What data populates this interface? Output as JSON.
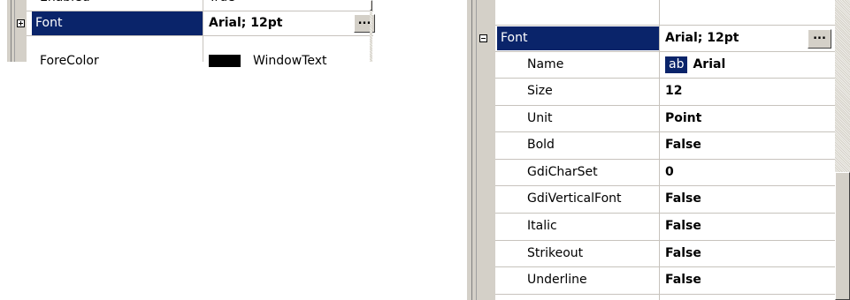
{
  "left_grid": {
    "prev_row": {
      "name": "Enabled",
      "value": "True"
    },
    "font_row": {
      "name": "Font",
      "value": "Arial; 12pt",
      "button": "..."
    },
    "next_row": {
      "name": "ForeColor",
      "value": "WindowText",
      "swatch_color": "#000000"
    }
  },
  "right_grid": {
    "font_row": {
      "name": "Font",
      "value": "Arial; 12pt",
      "button": "..."
    },
    "name_row": {
      "name": "Name",
      "preview": "ab",
      "value": "Arial"
    },
    "rows": [
      {
        "name": "Size",
        "value": "12"
      },
      {
        "name": "Unit",
        "value": "Point"
      },
      {
        "name": "Bold",
        "value": "False"
      },
      {
        "name": "GdiCharSet",
        "value": "0"
      },
      {
        "name": "GdiVerticalFont",
        "value": "False"
      },
      {
        "name": "Italic",
        "value": "False"
      },
      {
        "name": "Strikeout",
        "value": "False"
      },
      {
        "name": "Underline",
        "value": "False"
      }
    ]
  },
  "colors": {
    "selection": "#0a246a",
    "gutter": "#d4d0c8",
    "gridline": "#c7c3bd"
  }
}
